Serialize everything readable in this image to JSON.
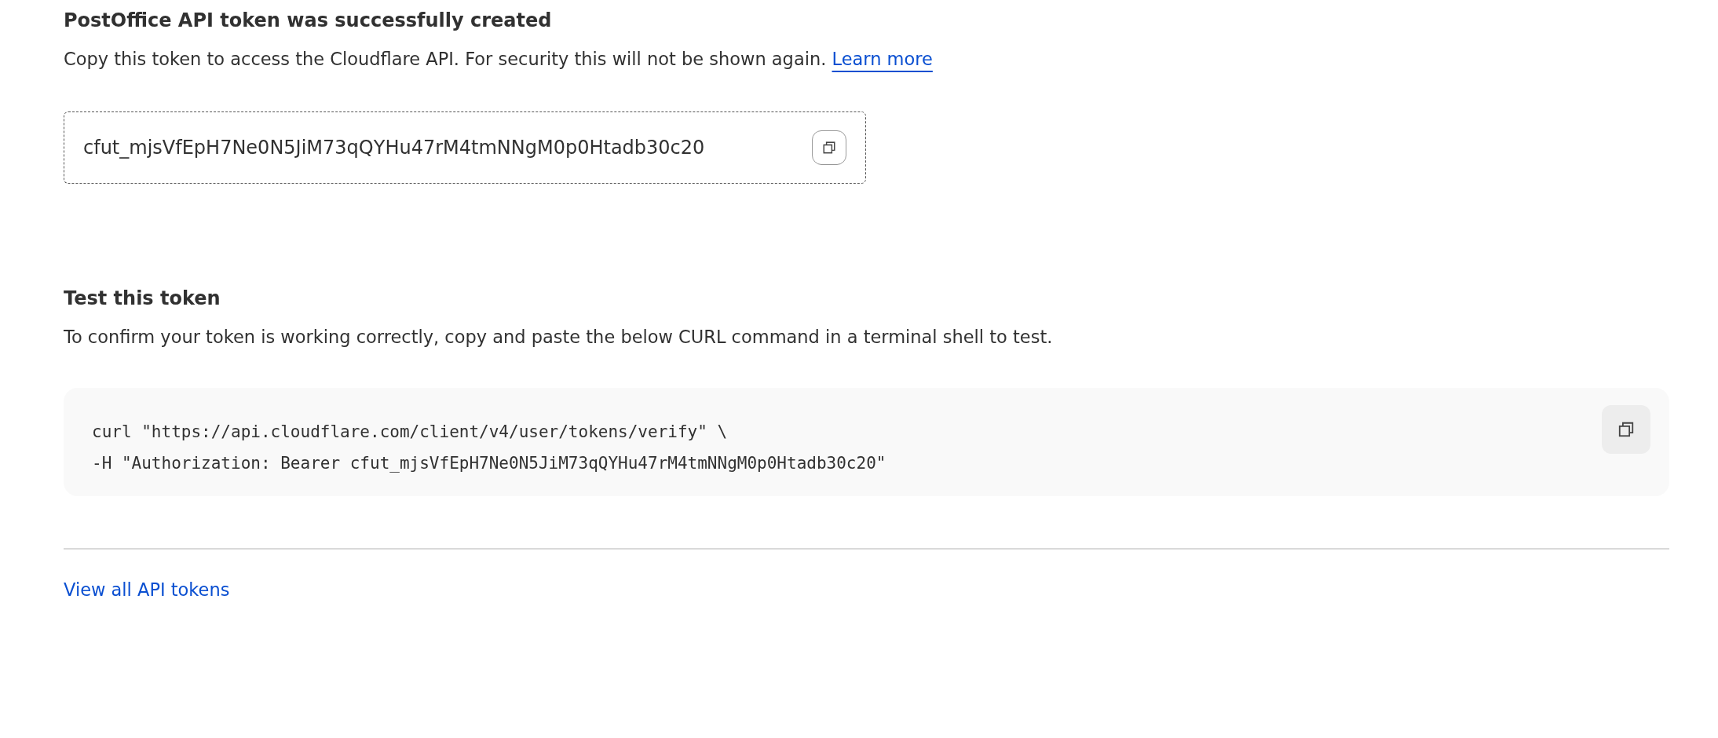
{
  "success": {
    "title": "PostOffice API token was successfully created",
    "description": "Copy this token to access the Cloudflare API. For security this will not be shown again.",
    "link": "Learn more"
  },
  "token": {
    "value": "cfut_mjsVfEpH7Ne0N5JiM73qQYHu47rM4tmNNgM0p0Htadb30c20"
  },
  "test": {
    "title": "Test this token",
    "description": "To confirm your token is working correctly, copy and paste the below CURL command in a terminal shell to test.",
    "code_lines": [
      "curl \"https://api.cloudflare.com/client/v4/user/tokens/verify\" \\",
      "-H \"Authorization: Bearer cfut_mjsVfEpH7Ne0N5JiM73qQYHu47rM4tmNNgM0p0Htadb30c20\""
    ]
  },
  "footer_link": "View all API tokens"
}
